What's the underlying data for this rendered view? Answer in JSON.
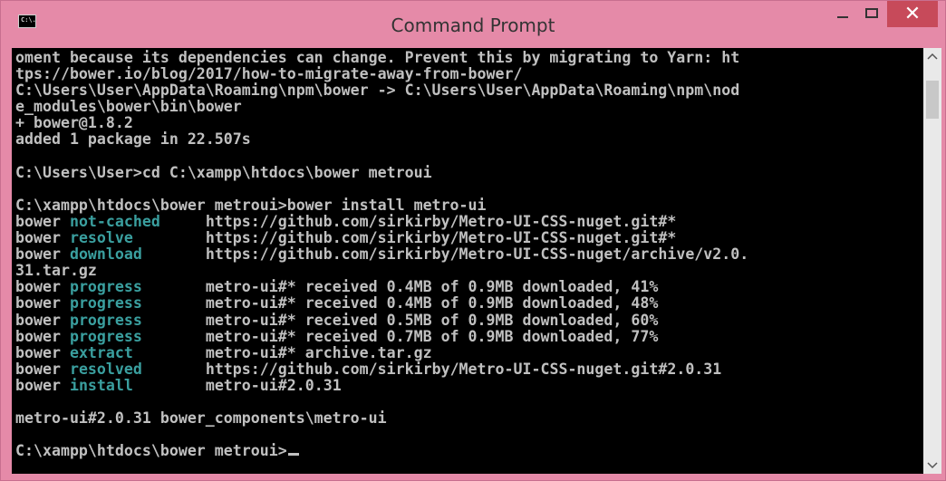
{
  "window": {
    "title": "Command Prompt",
    "icon": "cmd-icon",
    "icon_text": "C:\\.",
    "close_symbol": "✕"
  },
  "colors": {
    "titlebar": "#e58aa8",
    "close_button": "#c74a5a",
    "console_bg": "#000000",
    "console_text": "#c0c0c0",
    "highlight_text": "#3a9f9f"
  },
  "scrollbar": {
    "up_arrow": "^",
    "down_arrow": "v"
  },
  "console": {
    "lines": [
      {
        "text": "oment because its dependencies can change. Prevent this by migrating to Yarn: ht"
      },
      {
        "text": "tps://bower.io/blog/2017/how-to-migrate-away-from-bower/"
      },
      {
        "text": "C:\\Users\\User\\AppData\\Roaming\\npm\\bower -> C:\\Users\\User\\AppData\\Roaming\\npm\\nod"
      },
      {
        "text": "e_modules\\bower\\bin\\bower"
      },
      {
        "text": "+ bower@1.8.2"
      },
      {
        "text": "added 1 package in 22.507s"
      },
      {
        "text": ""
      },
      {
        "text": "C:\\Users\\User>cd C:\\xampp\\htdocs\\bower metroui"
      },
      {
        "text": ""
      },
      {
        "text": "C:\\xampp\\htdocs\\bower metroui>bower install metro-ui"
      },
      {
        "prefix": "bower ",
        "keyword": "not-cached",
        "pad": "     ",
        "rest": "https://github.com/sirkirby/Metro-UI-CSS-nuget.git#*"
      },
      {
        "prefix": "bower ",
        "keyword": "resolve",
        "pad": "        ",
        "rest": "https://github.com/sirkirby/Metro-UI-CSS-nuget.git#*"
      },
      {
        "prefix": "bower ",
        "keyword": "download",
        "pad": "       ",
        "rest": "https://github.com/sirkirby/Metro-UI-CSS-nuget/archive/v2.0."
      },
      {
        "text": "31.tar.gz"
      },
      {
        "prefix": "bower ",
        "keyword": "progress",
        "pad": "       ",
        "rest": "metro-ui#* received 0.4MB of 0.9MB downloaded, 41%"
      },
      {
        "prefix": "bower ",
        "keyword": "progress",
        "pad": "       ",
        "rest": "metro-ui#* received 0.4MB of 0.9MB downloaded, 48%"
      },
      {
        "prefix": "bower ",
        "keyword": "progress",
        "pad": "       ",
        "rest": "metro-ui#* received 0.5MB of 0.9MB downloaded, 60%"
      },
      {
        "prefix": "bower ",
        "keyword": "progress",
        "pad": "       ",
        "rest": "metro-ui#* received 0.7MB of 0.9MB downloaded, 77%"
      },
      {
        "prefix": "bower ",
        "keyword": "extract",
        "pad": "        ",
        "rest": "metro-ui#* archive.tar.gz"
      },
      {
        "prefix": "bower ",
        "keyword": "resolved",
        "pad": "       ",
        "rest": "https://github.com/sirkirby/Metro-UI-CSS-nuget.git#2.0.31"
      },
      {
        "prefix": "bower ",
        "keyword": "install",
        "pad": "        ",
        "rest": "metro-ui#2.0.31"
      },
      {
        "text": ""
      },
      {
        "text": "metro-ui#2.0.31 bower_components\\metro-ui"
      },
      {
        "text": ""
      },
      {
        "text": "C:\\xampp\\htdocs\\bower metroui>",
        "cursor": true
      }
    ]
  }
}
